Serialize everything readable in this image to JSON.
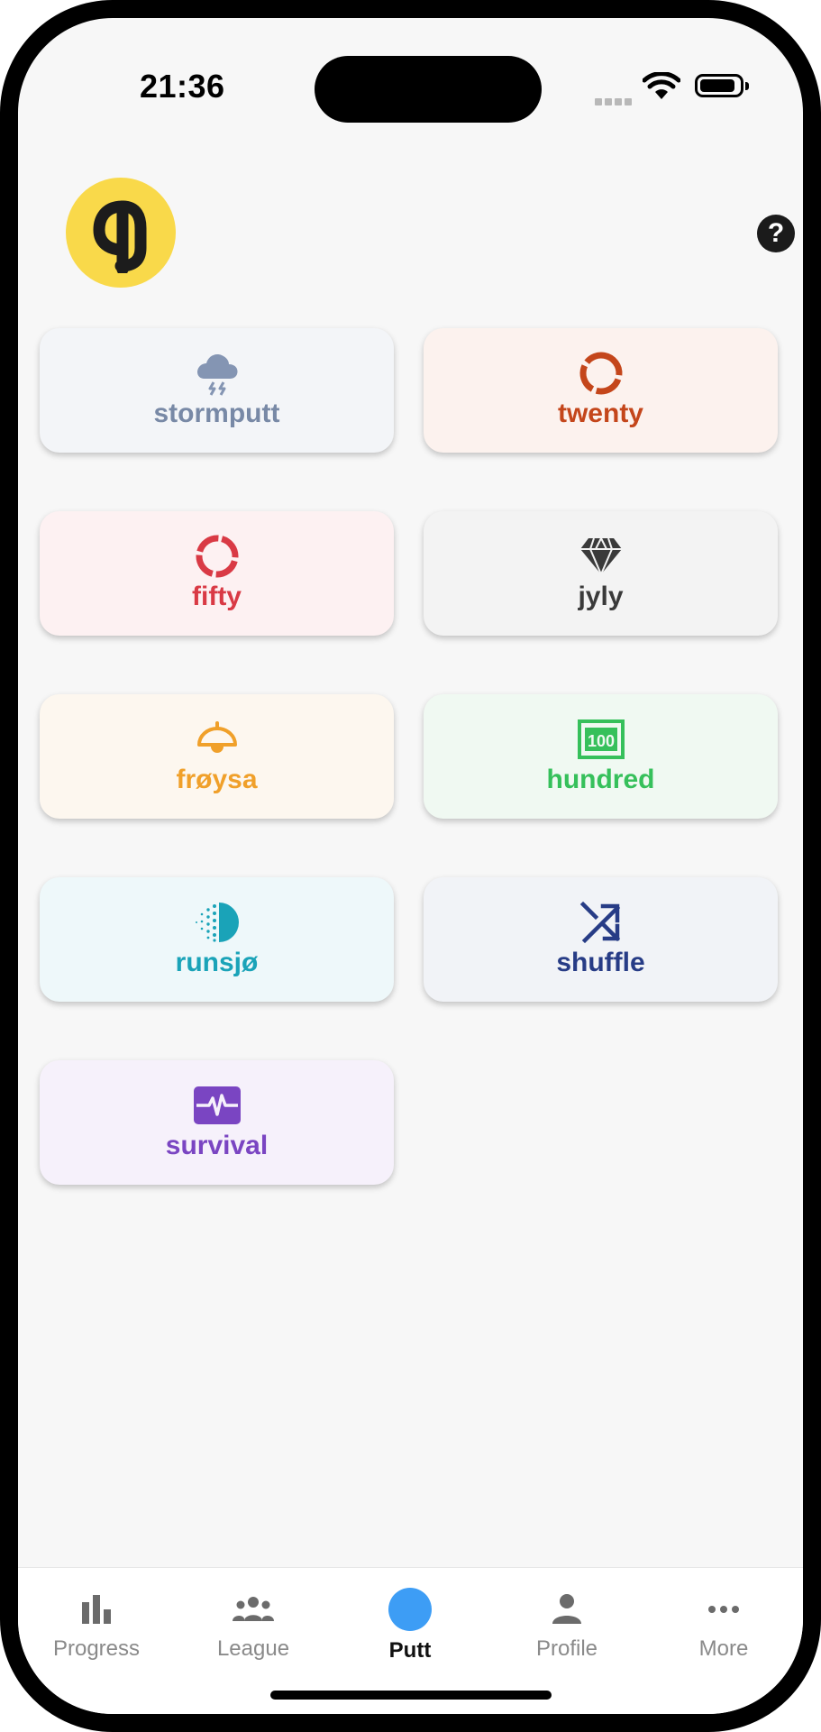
{
  "status_bar": {
    "time": "21:36"
  },
  "header": {
    "logo_text": "pg",
    "help_symbol": "?"
  },
  "games": [
    {
      "label": "stormputt",
      "icon": "storm-cloud-icon",
      "color": "#7889a6",
      "bg": "#f3f5f8"
    },
    {
      "label": "twenty",
      "icon": "ring-icon",
      "color": "#c4461b",
      "bg": "#fcf2ee"
    },
    {
      "label": "fifty",
      "icon": "ring-icon",
      "color": "#d93a45",
      "bg": "#fdf1f2"
    },
    {
      "label": "jyly",
      "icon": "diamond-icon",
      "color": "#3a3a3a",
      "bg": "#f3f3f3"
    },
    {
      "label": "frøysa",
      "icon": "bell-icon",
      "color": "#f0a02a",
      "bg": "#fdf7ef"
    },
    {
      "label": "hundred",
      "icon": "hundred-icon",
      "color": "#36c05b",
      "bg": "#f0f9f2"
    },
    {
      "label": "runsjø",
      "icon": "half-circle-icon",
      "color": "#1aa3b8",
      "bg": "#eef8fa"
    },
    {
      "label": "shuffle",
      "icon": "shuffle-icon",
      "color": "#273c86",
      "bg": "#f1f3f7"
    },
    {
      "label": "survival",
      "icon": "pulse-icon",
      "color": "#7a45c2",
      "bg": "#f6f1fb"
    }
  ],
  "tabbar": {
    "tabs": [
      {
        "label": "Progress",
        "icon": "bar-chart-icon"
      },
      {
        "label": "League",
        "icon": "group-icon"
      },
      {
        "label": "Putt",
        "icon": "putt-dot-icon",
        "active": true
      },
      {
        "label": "Profile",
        "icon": "person-icon"
      },
      {
        "label": "More",
        "icon": "more-dots-icon"
      }
    ]
  }
}
